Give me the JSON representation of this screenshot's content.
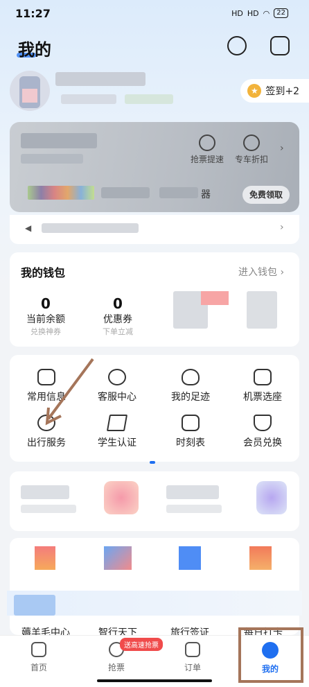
{
  "status_bar": {
    "time": "11:27",
    "signal_label": "HD",
    "battery": "22"
  },
  "header": {
    "title": "我的"
  },
  "profile": {
    "signin_label": "签到+2"
  },
  "vip_card": {
    "actions": [
      "抢票提速",
      "专车折扣"
    ],
    "suffix_char": "器",
    "cta": "免费领取"
  },
  "wallet": {
    "title": "我的钱包",
    "link": "进入钱包",
    "stats": [
      {
        "value": "0",
        "label": "当前余额",
        "sub": "兑换神券"
      },
      {
        "value": "0",
        "label": "优惠券",
        "sub": "下单立减"
      }
    ]
  },
  "services": [
    {
      "label": "常用信息",
      "icon": "id-card-icon"
    },
    {
      "label": "客服中心",
      "icon": "headset-icon"
    },
    {
      "label": "我的足迹",
      "icon": "footprint-icon"
    },
    {
      "label": "机票选座",
      "icon": "seat-icon"
    },
    {
      "label": "出行服务",
      "icon": "luggage-icon"
    },
    {
      "label": "学生认证",
      "icon": "grad-cap-icon"
    },
    {
      "label": "时刻表",
      "icon": "clock-icon"
    },
    {
      "label": "会员兑换",
      "icon": "gift-icon"
    }
  ],
  "grid2_labels": [
    "薅羊毛中心",
    "智行天下",
    "旅行签证",
    "每日打卡"
  ],
  "bottom_nav": {
    "tabs": [
      "首页",
      "抢票",
      "订单",
      "我的"
    ],
    "badge": "送高速抢票"
  },
  "colors": {
    "accent": "#1f6ff0",
    "badge": "#f04b4b",
    "annotation": "#a5755a"
  }
}
